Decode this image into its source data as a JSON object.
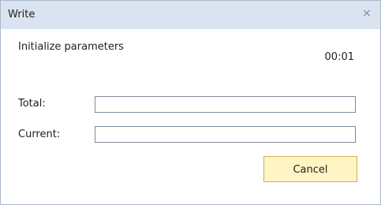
{
  "window": {
    "title": "Write",
    "close_icon": "×"
  },
  "status": {
    "message": "Initialize parameters",
    "elapsed": "00:01"
  },
  "progress": {
    "total_label": "Total:",
    "total_value": 0,
    "current_label": "Current:",
    "current_value": 0
  },
  "buttons": {
    "cancel_label": "Cancel"
  },
  "colors": {
    "titlebar": "#dae3f0",
    "button_bg": "#fff4c4",
    "button_border": "#c8b25f"
  },
  "icons": {
    "close": "close-icon"
  }
}
